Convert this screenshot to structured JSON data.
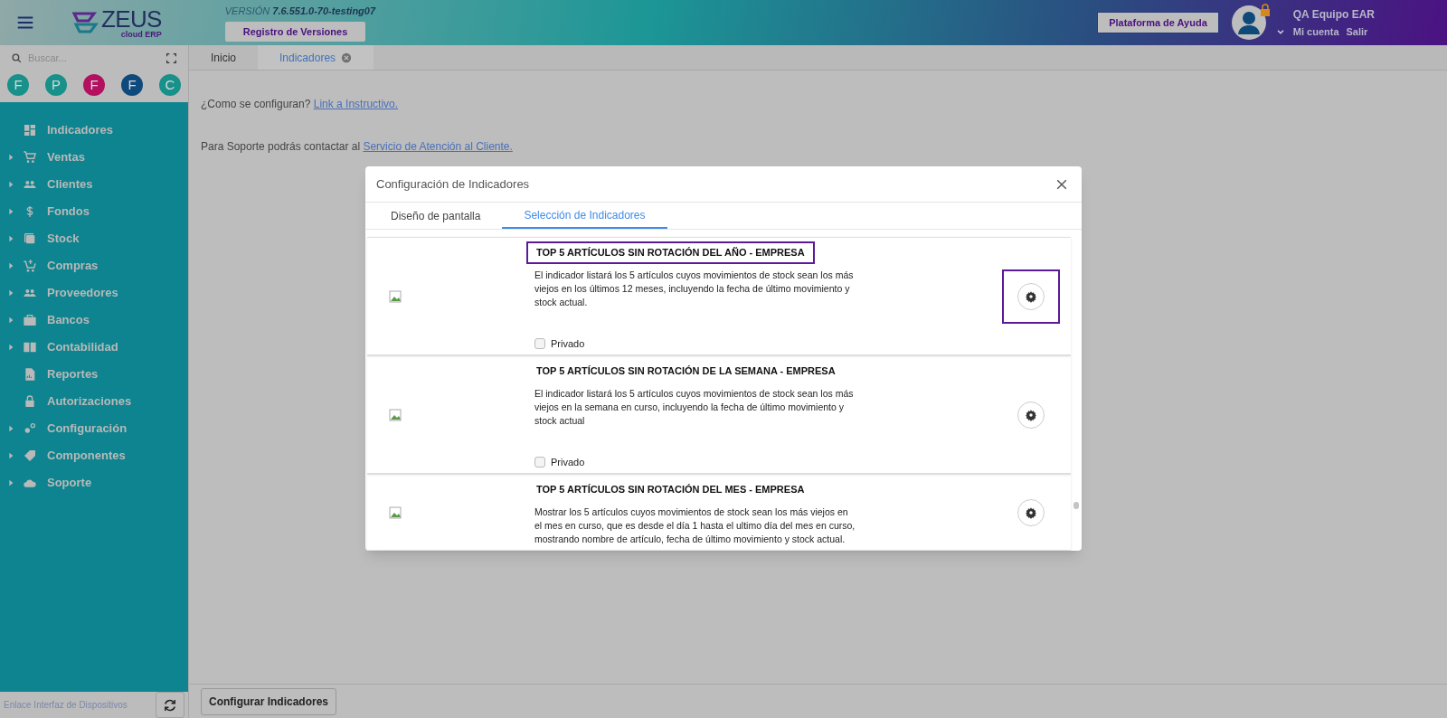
{
  "header": {
    "version_label": "VERSIÓN",
    "version": "7.6.551.0-70-testing07",
    "versions_button": "Registro de Versiones",
    "help_button": "Plataforma de Ayuda",
    "user": "QA Equipo EAR",
    "account_link": "Mi cuenta",
    "logout_link": "Salir",
    "logo_text": "ZEUS",
    "logo_sub": "cloud ERP"
  },
  "sidebar": {
    "search_placeholder": "Buscar...",
    "shortcuts": [
      {
        "letter": "F",
        "color": "#17918a"
      },
      {
        "letter": "P",
        "color": "#17918a"
      },
      {
        "letter": "F",
        "color": "#b3105f"
      },
      {
        "letter": "F",
        "color": "#0f4a7c"
      },
      {
        "letter": "C",
        "color": "#17918a"
      }
    ],
    "items": [
      {
        "label": "Indicadores",
        "kind": "dashboard",
        "expandable": false
      },
      {
        "label": "Ventas",
        "kind": "cart",
        "expandable": true
      },
      {
        "label": "Clientes",
        "kind": "people",
        "expandable": true
      },
      {
        "label": "Fondos",
        "kind": "dollar",
        "expandable": true
      },
      {
        "label": "Stock",
        "kind": "stack",
        "expandable": true
      },
      {
        "label": "Compras",
        "kind": "cartplus",
        "expandable": true
      },
      {
        "label": "Proveedores",
        "kind": "people",
        "expandable": true
      },
      {
        "label": "Bancos",
        "kind": "briefcase",
        "expandable": true
      },
      {
        "label": "Contabilidad",
        "kind": "book",
        "expandable": true
      },
      {
        "label": "Reportes",
        "kind": "report",
        "expandable": false
      },
      {
        "label": "Autorizaciones",
        "kind": "lock",
        "expandable": false
      },
      {
        "label": "Configuración",
        "kind": "gears",
        "expandable": true
      },
      {
        "label": "Componentes",
        "kind": "tag",
        "expandable": true
      },
      {
        "label": "Soporte",
        "kind": "cloud",
        "expandable": true
      }
    ],
    "footer_text": "Enlace Interfaz de Dispositivos"
  },
  "tabs": [
    {
      "label": "Inicio",
      "selected": false,
      "closable": false
    },
    {
      "label": "Indicadores",
      "selected": true,
      "closable": true
    }
  ],
  "content": {
    "line1_text": "¿Como se configuran?",
    "line1_link": "Link a Instructivo.",
    "line2_text": "Para Soporte podrás contactar al",
    "line2_link": "Servicio de Atención al Cliente."
  },
  "footer_button": "Configurar Indicadores",
  "modal": {
    "title": "Configuración de Indicadores",
    "tabs": [
      {
        "label": "Diseño de pantalla",
        "selected": false
      },
      {
        "label": "Selección de Indicadores",
        "selected": true
      }
    ],
    "cards": [
      {
        "title": "TOP 5 ARTÍCULOS SIN ROTACIÓN DEL AÑO - EMPRESA",
        "description": "El indicador listará los 5 artículos cuyos movimientos de stock sean los más viejos en los últimos 12 meses, incluyendo la fecha de último movimiento y stock actual.",
        "private_label": "Privado",
        "private": false,
        "highlighted": true
      },
      {
        "title": "TOP 5 ARTÍCULOS SIN ROTACIÓN DE LA SEMANA - EMPRESA",
        "description": "El indicador listará los 5 artículos cuyos movimientos de stock sean los más viejos en la semana en curso, incluyendo la fecha de último movimiento y stock actual",
        "private_label": "Privado",
        "private": false,
        "highlighted": false
      },
      {
        "title": "TOP 5 ARTÍCULOS SIN ROTACIÓN DEL MES - EMPRESA",
        "description": "Mostrar los 5 artículos cuyos movimientos de stock sean los más viejos en el mes en curso, que es desde el día 1 hasta el ultimo día del mes en curso, mostrando nombre de artículo, fecha de último movimiento y stock actual.",
        "highlighted": false
      }
    ]
  }
}
